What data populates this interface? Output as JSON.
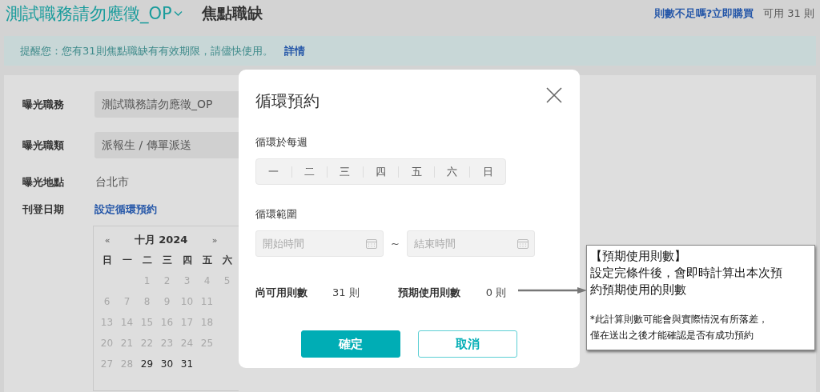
{
  "header": {
    "job_title": "測試職務請勿應徵_OP",
    "page_title": "焦點職缺",
    "buy_link": "則數不足嗎?立即購買",
    "available": "可用 31 則"
  },
  "notice": {
    "text": "提醒您：您有31則焦點職缺有有效期限，請儘快使用。",
    "link": "詳情"
  },
  "form": {
    "fields": [
      {
        "label": "曝光職務",
        "value": "測試職務請勿應徵_OP",
        "kind": "field"
      },
      {
        "label": "曝光職類",
        "value": "派報生 / 傳單派送",
        "kind": "field"
      },
      {
        "label": "曝光地點",
        "value": "台北市",
        "kind": "text"
      },
      {
        "label": "刊登日期",
        "value": "設定循環預約",
        "kind": "link"
      }
    ],
    "calendar": {
      "prev": "«",
      "month": "十月 2024",
      "next": "»",
      "weekdays": [
        "日",
        "一",
        "二",
        "三",
        "四",
        "五",
        "六"
      ],
      "weeks": [
        {
          "kind": "partial",
          "days": [
            {
              "day": "1",
              "disabled": true
            },
            {
              "day": "2",
              "disabled": true
            },
            {
              "day": "3",
              "disabled": true
            },
            {
              "day": "4",
              "disabled": true
            },
            {
              "day": "5",
              "disabled": true
            }
          ]
        },
        {
          "kind": "full",
          "days": [
            {
              "day": "6",
              "disabled": true
            },
            {
              "day": "7",
              "disabled": true
            },
            {
              "day": "8",
              "disabled": true
            },
            {
              "day": "9",
              "disabled": true
            },
            {
              "day": "10",
              "disabled": true
            },
            {
              "day": "11",
              "disabled": true
            }
          ]
        },
        {
          "kind": "full",
          "days": [
            {
              "day": "13",
              "disabled": true
            },
            {
              "day": "14",
              "disabled": true
            },
            {
              "day": "15",
              "disabled": true
            },
            {
              "day": "16",
              "disabled": true
            },
            {
              "day": "17",
              "disabled": true
            },
            {
              "day": "18",
              "disabled": true
            }
          ]
        },
        {
          "kind": "full",
          "days": [
            {
              "day": "20",
              "disabled": true
            },
            {
              "day": "21",
              "disabled": true
            },
            {
              "day": "22",
              "disabled": true
            },
            {
              "day": "23",
              "disabled": true
            },
            {
              "day": "24",
              "disabled": true
            },
            {
              "day": "25",
              "disabled": true
            }
          ]
        },
        {
          "kind": "full",
          "days": [
            {
              "day": "27",
              "disabled": true
            },
            {
              "day": "28",
              "disabled": true
            },
            {
              "day": "29",
              "disabled": false
            },
            {
              "day": "30",
              "disabled": false
            },
            {
              "day": "31",
              "disabled": false
            }
          ]
        }
      ]
    }
  },
  "modal": {
    "title": "循環預約",
    "weekly_label": "循環於每週",
    "days": [
      {
        "label": "一",
        "selected": false
      },
      {
        "label": "二",
        "selected": false
      },
      {
        "label": "三",
        "selected": false
      },
      {
        "label": "四",
        "selected": false
      },
      {
        "label": "五",
        "selected": false
      },
      {
        "label": "六",
        "selected": false
      },
      {
        "label": "日",
        "selected": false
      }
    ],
    "range_label": "循環範圍",
    "start_placeholder": "開始時間",
    "separator": "~",
    "end_placeholder": "結束時間",
    "remaining_label": "尚可用則數",
    "remaining": "31 則",
    "expected_label": "預期使用則數",
    "expected": "0 則",
    "confirm": "確定",
    "cancel": "取消"
  },
  "callout": {
    "title": "【預期使用則數】",
    "text": "設定完條件後，會即時計算出本次預約預期使用的則數",
    "note": "*此計算則數可能會與實際情況有所落差，僅在送出之後才能確認是否有成功預約"
  }
}
